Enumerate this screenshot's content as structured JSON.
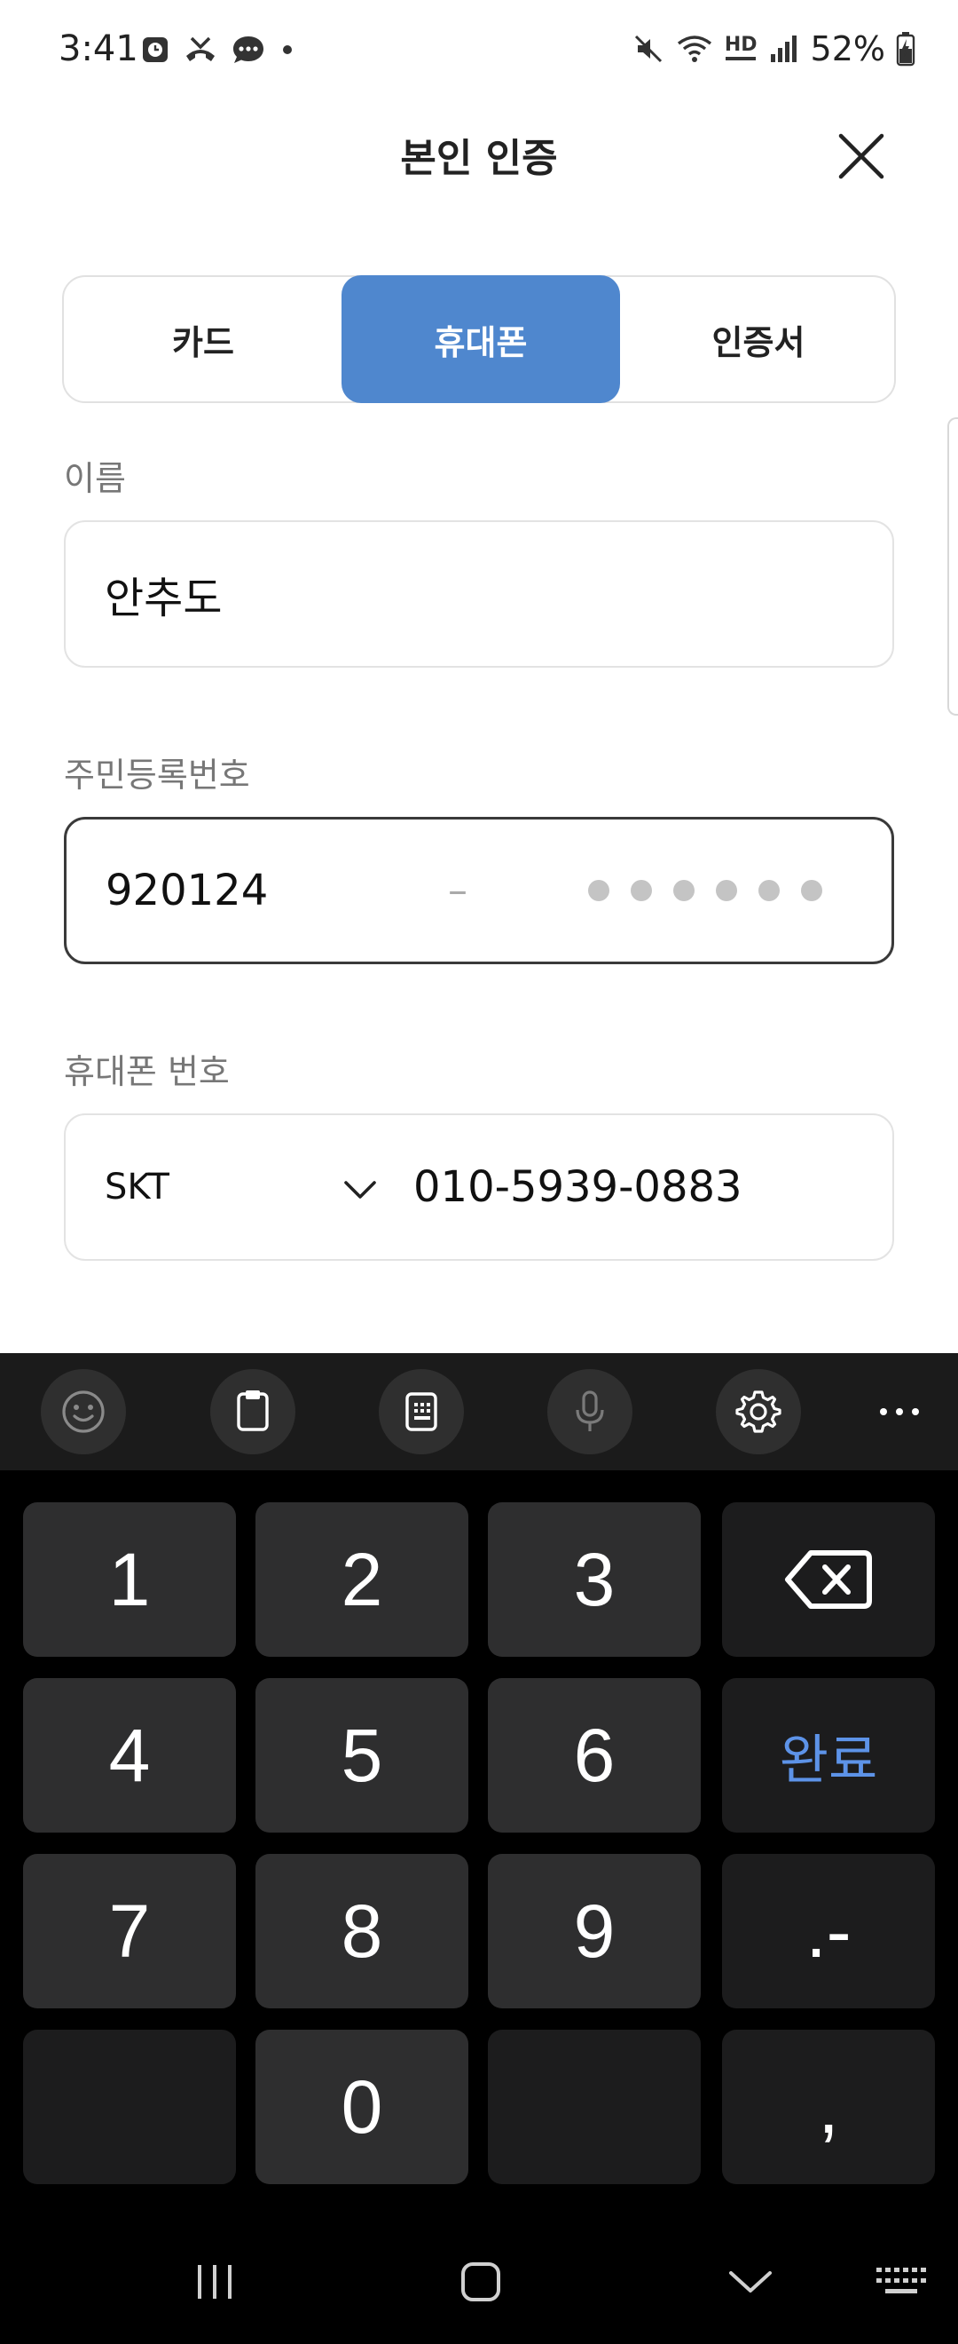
{
  "status_bar": {
    "time": "3:41",
    "battery_text": "52%",
    "network_label": "HD"
  },
  "header": {
    "title": "본인 인증",
    "close_icon": "close-icon"
  },
  "tabs": [
    {
      "label": "카드",
      "selected": false
    },
    {
      "label": "휴대폰",
      "selected": true
    },
    {
      "label": "인증서",
      "selected": false
    }
  ],
  "form": {
    "name_label": "이름",
    "name_value": "안추도",
    "rrn_label": "주민등록번호",
    "rrn_front": "920124",
    "rrn_dash": "–",
    "phone_label": "휴대폰 번호",
    "carrier": "SKT",
    "phone_value": "010-5939-0883"
  },
  "keyboard": {
    "toolbar": [
      "emoji-icon",
      "clipboard-icon",
      "keypad-icon",
      "mic-icon",
      "settings-icon",
      "more-icon"
    ],
    "keys": {
      "k1": "1",
      "k2": "2",
      "k3": "3",
      "k4": "4",
      "k5": "5",
      "k6": "6",
      "k7": "7",
      "k8": "8",
      "k9": "9",
      "k0": "0",
      "done": "완료",
      "dot_dash": ".-",
      "comma": ","
    }
  },
  "colors": {
    "accent": "#4f87ce",
    "done_key": "#5d93e8",
    "key_bg": "#2e2e2f"
  }
}
